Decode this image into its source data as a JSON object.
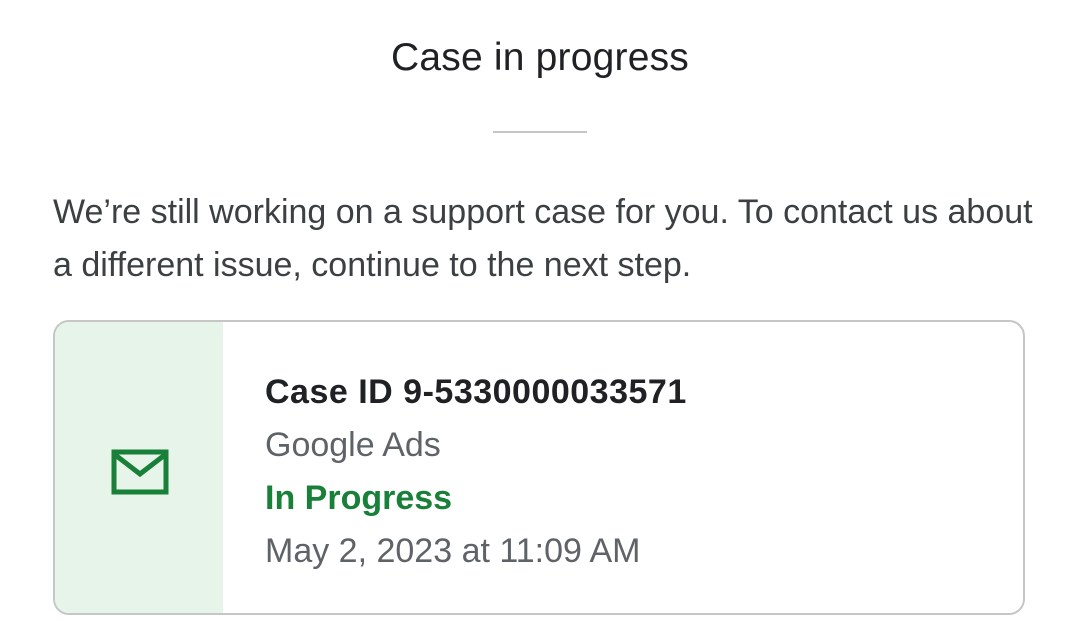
{
  "dialog": {
    "title": "Case in progress",
    "description": "We’re still working on a support case for you. To contact us about a different issue, continue to the next step."
  },
  "case": {
    "icon": "mail-icon",
    "id_label": "Case ID 9-5330000033571",
    "product": "Google Ads",
    "status": "In Progress",
    "created": "May 2, 2023 at 11:09 AM",
    "colors": {
      "status": "#188038",
      "icon": "#188038",
      "icon_panel_bg": "#e6f4ea"
    }
  }
}
